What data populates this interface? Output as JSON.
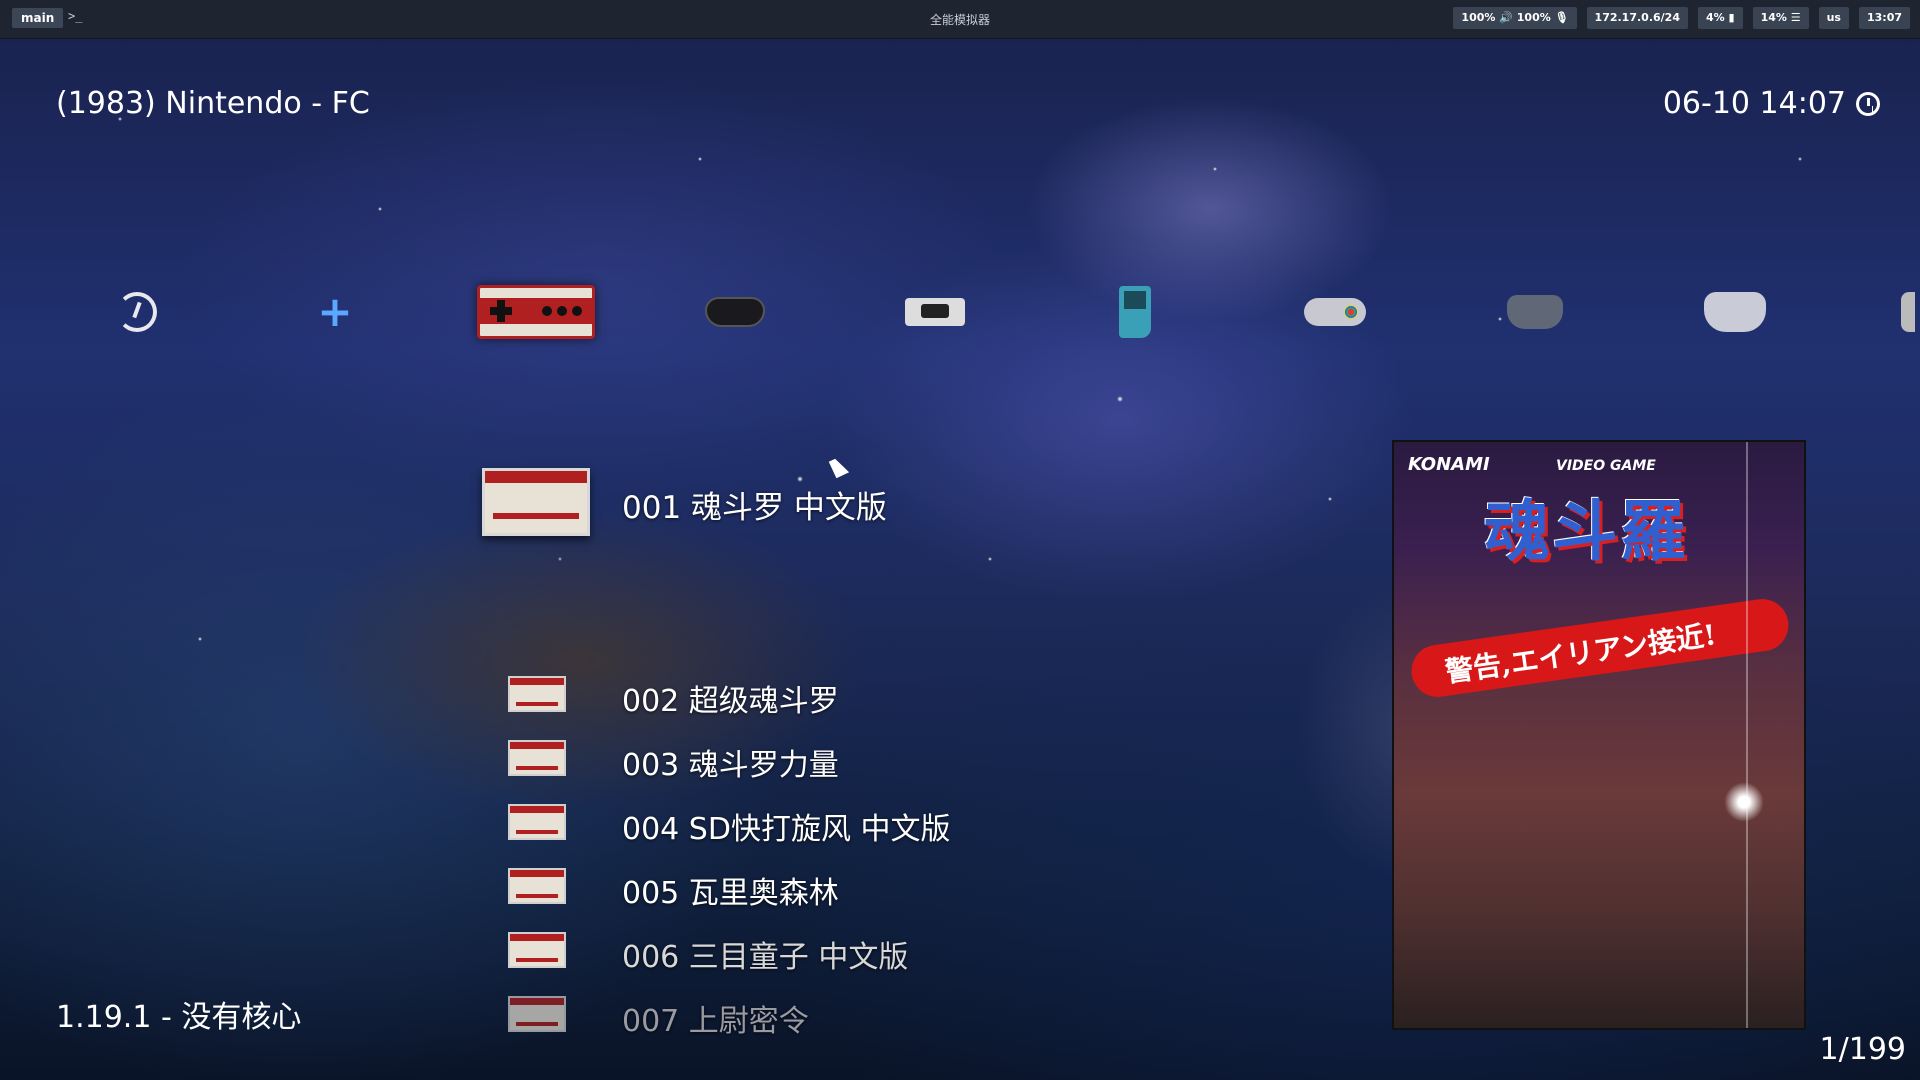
{
  "topbar": {
    "workspace": "main",
    "prompt_glyph": ">_",
    "window_title": "全能模拟器",
    "status": [
      "100% 🔊 100% 🎙",
      "172.17.0.6/24",
      "4% ▮",
      "14% ☰",
      "us",
      "13:07"
    ]
  },
  "header": {
    "system_title": "(1983) Nintendo - FC",
    "datetime": "06-10 14:07"
  },
  "tabs": [
    {
      "name": "history",
      "icon": "history-icon"
    },
    {
      "name": "add",
      "icon": "plus-icon"
    },
    {
      "name": "nintendo-fc",
      "icon": "famicom-icon",
      "selected": true
    },
    {
      "name": "sega-genesis",
      "icon": "gamepad-icon"
    },
    {
      "name": "console",
      "icon": "console-icon"
    },
    {
      "name": "gameboy-color",
      "icon": "gameboy-icon"
    },
    {
      "name": "snes",
      "icon": "snes-pad-icon"
    },
    {
      "name": "n64",
      "icon": "n64-pad-icon"
    },
    {
      "name": "playstation",
      "icon": "ps-pad-icon"
    }
  ],
  "games": [
    {
      "label": "001 魂斗罗 中文版",
      "selected": true
    },
    {
      "label": "002 超级魂斗罗"
    },
    {
      "label": "003 魂斗罗力量"
    },
    {
      "label": "004 SD快打旋风 中文版"
    },
    {
      "label": "005 瓦里奥森林"
    },
    {
      "label": "006 三目童子 中文版"
    },
    {
      "label": "007 上尉密令"
    }
  ],
  "boxart": {
    "publisher": "KONAMI",
    "tag": "VIDEO GAME",
    "logo": "魂斗羅",
    "banner": "警告,エイリアン接近!"
  },
  "footer": {
    "version": "1.19.1 - 没有核心",
    "counter": "1/199"
  },
  "colors": {
    "topbar": "#1e2530",
    "accent_red": "#b02020",
    "plus_blue": "#5aa8ff"
  }
}
